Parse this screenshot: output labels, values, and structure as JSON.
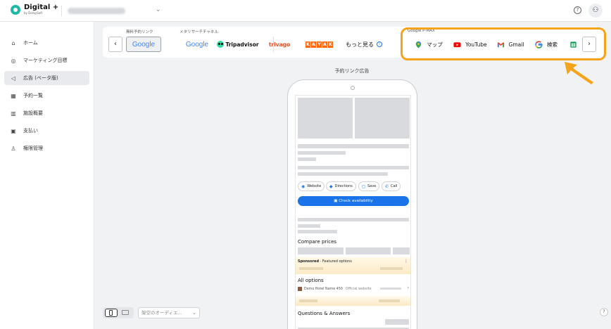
{
  "brand": {
    "name": "Digital +",
    "byline": "by DerbySoft"
  },
  "header": {
    "account_chevron": "⌄",
    "help_glyph": "?",
    "user_glyph": "⚇"
  },
  "sidebar": {
    "items": [
      {
        "label": "ホーム",
        "icon": "home-icon",
        "glyph": "⌂",
        "active": false
      },
      {
        "label": "マーケティング目標",
        "icon": "target-icon",
        "glyph": "◎",
        "active": false
      },
      {
        "label": "広告 (ベータ版)",
        "icon": "megaphone-icon",
        "glyph": "◁",
        "active": true
      },
      {
        "label": "予約一覧",
        "icon": "calendar-icon",
        "glyph": "▦",
        "active": false
      },
      {
        "label": "施設概要",
        "icon": "building-icon",
        "glyph": "▥",
        "active": false
      },
      {
        "label": "支払い",
        "icon": "wallet-icon",
        "glyph": "▣",
        "active": false
      },
      {
        "label": "権限管理",
        "icon": "user-permission-icon",
        "glyph": "♙",
        "active": false
      }
    ]
  },
  "channel_bar": {
    "groups": {
      "free": "無料予約リンク",
      "meta": "メタリサーチチャネル",
      "pmax": "Google P-MAX"
    },
    "prev_arrow": "‹",
    "next_arrow": "›",
    "free_channels": [
      {
        "label": "Google",
        "selected": true
      }
    ],
    "meta_channels": [
      {
        "label": "Google"
      },
      {
        "label": "Tripadvisor"
      },
      {
        "label": "trivago"
      },
      {
        "label": "KAYAK"
      }
    ],
    "more_label": "もっと見る",
    "info_glyph": "i",
    "pmax_channels": [
      {
        "label": "マップ",
        "icon": "google-maps-icon"
      },
      {
        "label": "YouTube",
        "icon": "youtube-icon"
      },
      {
        "label": "Gmail",
        "icon": "gmail-icon"
      },
      {
        "label": "検索",
        "icon": "google-search-icon"
      },
      {
        "label": "",
        "icon": "google-sheets-icon"
      }
    ]
  },
  "preview": {
    "title": "予約リンク広告",
    "buttons": [
      {
        "label": "Website",
        "glyph": "◉"
      },
      {
        "label": "Directions",
        "glyph": "◆"
      },
      {
        "label": "Save",
        "glyph": "◻"
      },
      {
        "label": "Call",
        "glyph": "✆"
      }
    ],
    "cta": "Check availability",
    "cta_glyph": "▣",
    "compare_prices": "Compare prices",
    "sponsored_label": "Sponsored",
    "featured_label": " · Featured options",
    "more_dots": "⋮",
    "all_options": "All options",
    "hotel_name": "Demo Hotel Name 450",
    "official_site": "Official website",
    "row_chevron": "›",
    "qa_title": "Questions & Answers"
  },
  "bottom": {
    "audience_placeholder": "架空のオーディエ...",
    "select_chevron": "⌄",
    "help_glyph": "?"
  },
  "colors": {
    "accent": "#1a73e8",
    "highlight": "#f5a31a",
    "brand": "#1fb8a6"
  }
}
